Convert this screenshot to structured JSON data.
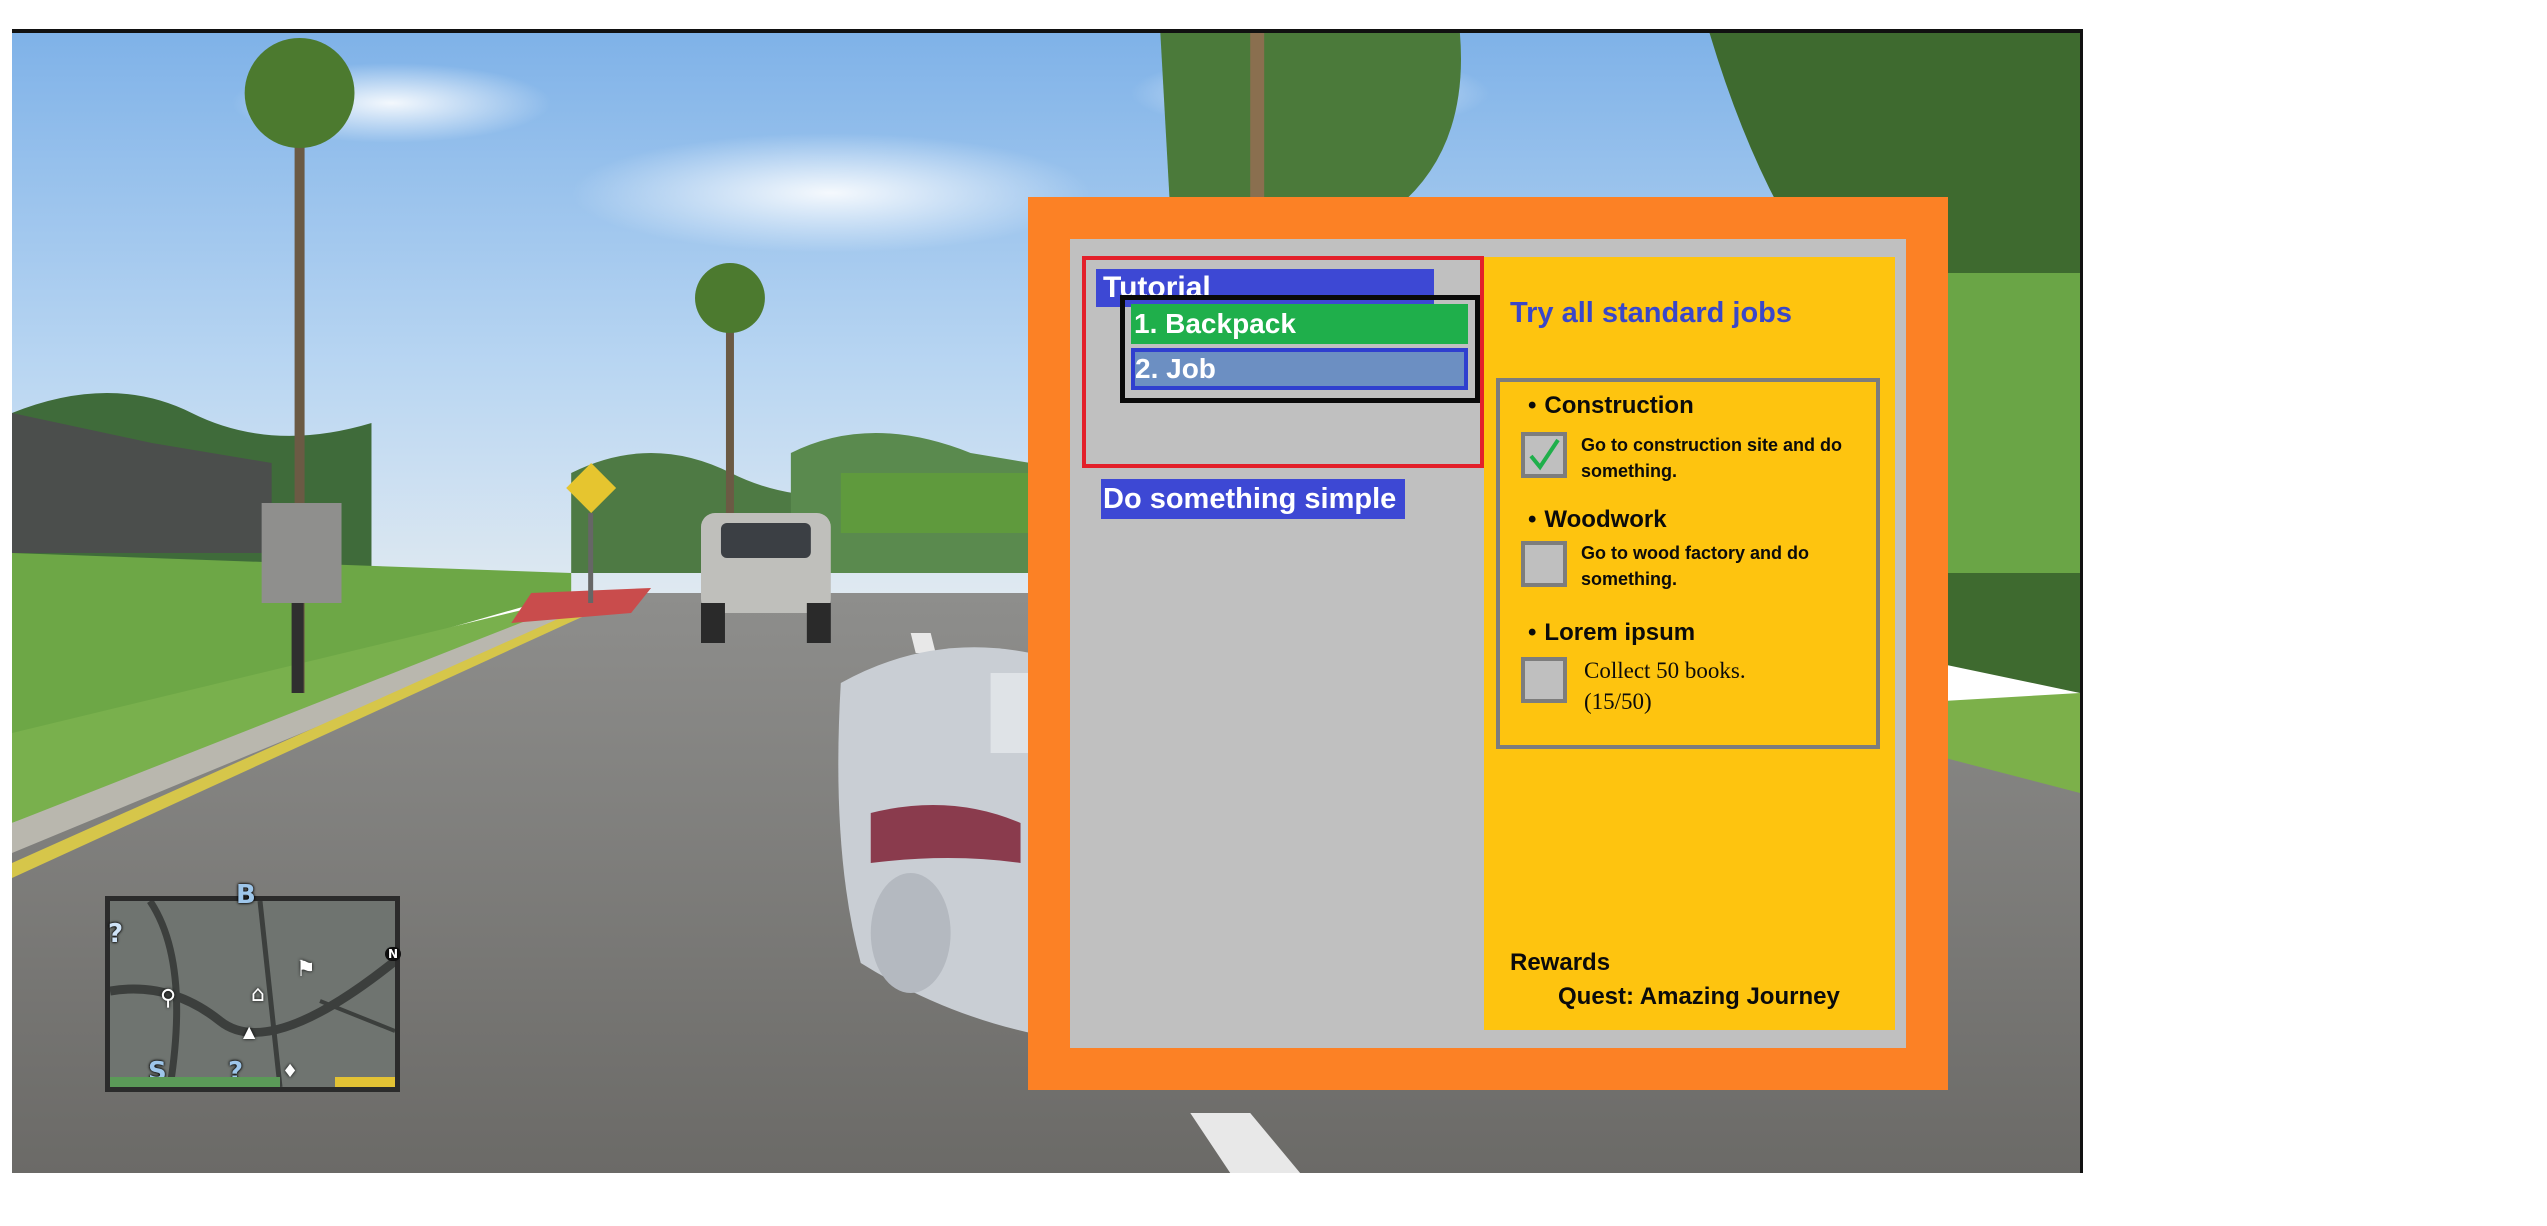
{
  "minimap": {
    "top_letter": "B",
    "bottom_left_letter": "S",
    "bottom_question": "?",
    "left_question": "?",
    "north_marker": "N",
    "icons": [
      "question-icon",
      "home-icon",
      "flag-icon",
      "player-arrow-icon",
      "shirt-icon",
      "magnifier-icon"
    ]
  },
  "quest": {
    "tutorial": {
      "title": "Tutorial",
      "items": [
        {
          "label": "1. Backpack",
          "state": "completed"
        },
        {
          "label": "2. Job",
          "state": "selected"
        }
      ]
    },
    "other_quest": {
      "title": "Do something simple"
    },
    "detail": {
      "title": "Try all standard jobs",
      "jobs": [
        {
          "name": "Construction",
          "description": "Go to construction site and do something.",
          "done": true
        },
        {
          "name": "Woodwork",
          "description": "Go to wood factory and do something.",
          "done": false
        },
        {
          "name": "Lorem ipsum",
          "description": "Collect 50 books.",
          "progress": "(15/50)",
          "done": false
        }
      ],
      "rewards_label": "Rewards",
      "rewards_value": "Quest: Amazing Journey"
    }
  },
  "colors": {
    "panel_orange": "#fc8125",
    "inner_gray": "#c0c0c0",
    "detail_yellow": "#fec40f",
    "header_blue": "#3d48d4",
    "completed_green": "#1faf4b",
    "selected_blue": "#6c8fc2",
    "group_red": "#e3202a",
    "check_green": "#1faf4b"
  }
}
